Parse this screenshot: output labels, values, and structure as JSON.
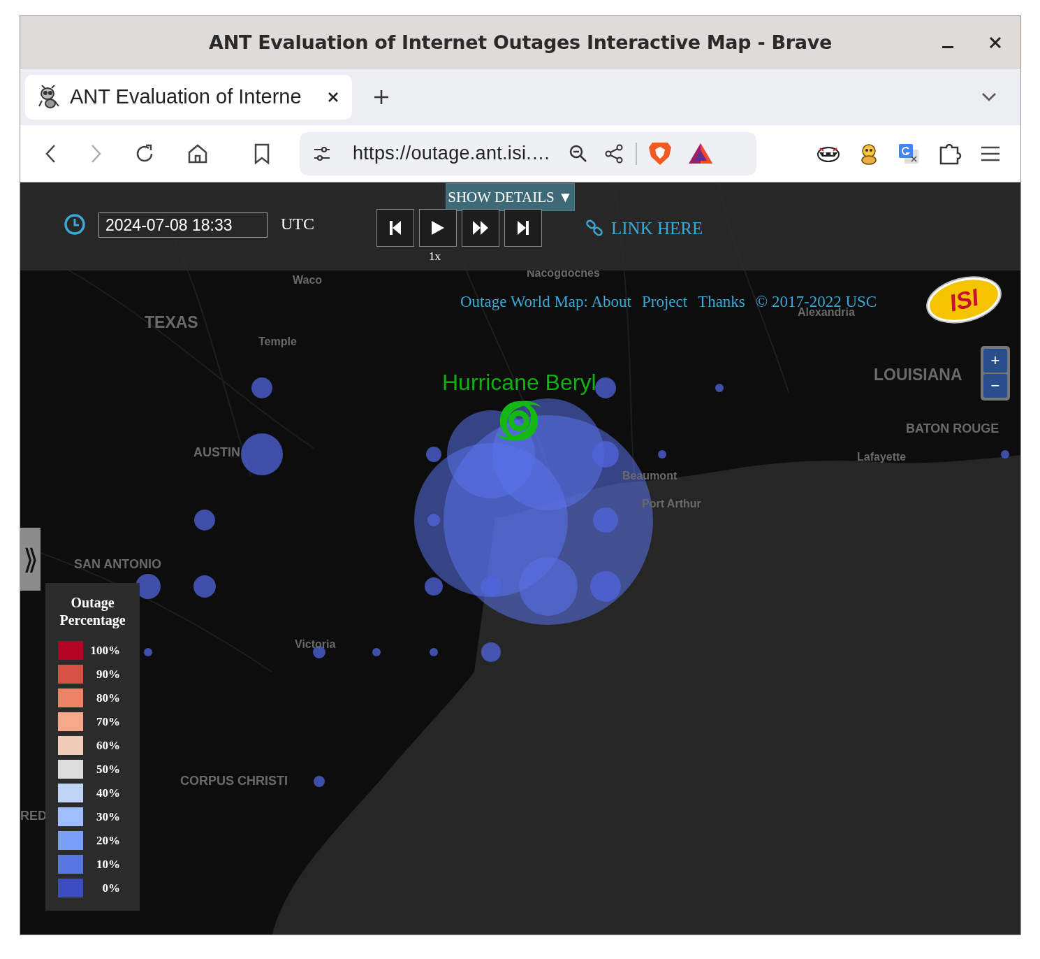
{
  "window": {
    "title": "ANT Evaluation of Internet Outages Interactive Map - Brave"
  },
  "tab": {
    "title": "ANT Evaluation of Interne",
    "selected": true
  },
  "toolbar": {
    "url": "https://outage.ant.isi.…"
  },
  "controls": {
    "datetime": "2024-07-08 18:33",
    "timezone": "UTC",
    "show_details": "SHOW DETAILS ▼",
    "speed": "1x",
    "link": "LINK HERE"
  },
  "links": [
    {
      "text": "Outage World Map: About"
    },
    {
      "text": "Project"
    },
    {
      "text": "Thanks"
    },
    {
      "text": "© 2017-2022 USC"
    }
  ],
  "logo": {
    "text": "ISI"
  },
  "zoom": [
    "+",
    "−"
  ],
  "panel_toggle": "⟫",
  "map_labels": [
    {
      "text": "TEXAS",
      "kind": "state"
    },
    {
      "text": "Waco",
      "kind": "city"
    },
    {
      "text": "Temple",
      "kind": "city"
    },
    {
      "text": "AUSTIN",
      "kind": "major"
    },
    {
      "text": "SAN ANTONIO",
      "kind": "major"
    },
    {
      "text": "Victoria",
      "kind": "city"
    },
    {
      "text": "CORPUS CHRISTI",
      "kind": "major"
    },
    {
      "text": "RED",
      "kind": "major"
    },
    {
      "text": "Nacogdoches",
      "kind": "city"
    },
    {
      "text": "Alexandria",
      "kind": "city"
    },
    {
      "text": "LOUISIANA",
      "kind": "state"
    },
    {
      "text": "BATON ROUGE",
      "kind": "major"
    },
    {
      "text": "Lafayette",
      "kind": "city"
    },
    {
      "text": "Beaumont",
      "kind": "city"
    },
    {
      "text": "Port Arthur",
      "kind": "city"
    }
  ],
  "hurricane": {
    "label": "Hurricane Beryl"
  },
  "legend": {
    "title": "Outage Percentage",
    "items": [
      {
        "label": "100%",
        "color": "#b40426"
      },
      {
        "label": "90%",
        "color": "#d65244"
      },
      {
        "label": "80%",
        "color": "#ed8366"
      },
      {
        "label": "70%",
        "color": "#f6a98a"
      },
      {
        "label": "60%",
        "color": "#f0cbb8"
      },
      {
        "label": "50%",
        "color": "#dddddd"
      },
      {
        "label": "40%",
        "color": "#c0d4f5"
      },
      {
        "label": "30%",
        "color": "#9ebeff"
      },
      {
        "label": "20%",
        "color": "#7b9ff9"
      },
      {
        "label": "10%",
        "color": "#5977e3"
      },
      {
        "label": "0%",
        "color": "#3b4cc0"
      }
    ]
  }
}
